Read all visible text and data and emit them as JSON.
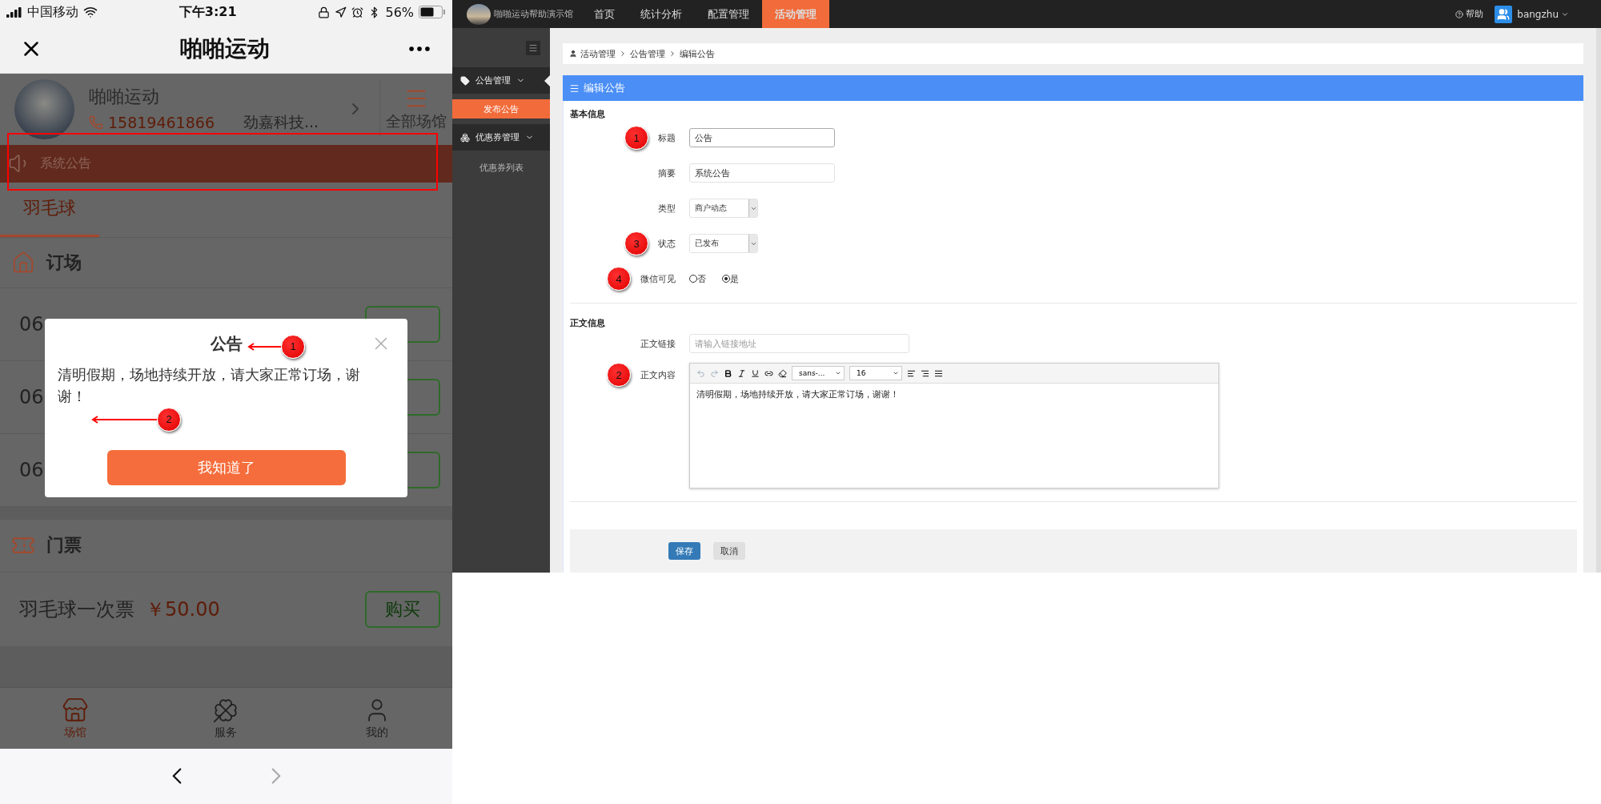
{
  "phone": {
    "status_bar": {
      "carrier": "中国移动",
      "time": "下午3:21",
      "battery": "56%"
    },
    "nav_bar": {
      "title": "啪啪运动"
    },
    "venue": {
      "name": "啪啪运动",
      "phone": "15819461866",
      "company": "劲嘉科技...",
      "all_venues": "全部场馆"
    },
    "notice_bar": {
      "text": "系统公告",
      "highlighted": true
    },
    "sport_tabs": [
      {
        "label": "羽毛球",
        "selected": true
      }
    ],
    "booking": {
      "title": "订场",
      "rows": [
        {
          "label": "06"
        },
        {
          "label": "06"
        },
        {
          "label": "06"
        }
      ]
    },
    "tickets": {
      "title": "门票",
      "items": [
        {
          "name": "羽毛球一次票",
          "price": "￥50.00",
          "button": "购买"
        }
      ]
    },
    "tab_bar": [
      {
        "label": "场馆",
        "selected": true
      },
      {
        "label": "服务",
        "selected": false
      },
      {
        "label": "我的",
        "selected": false
      }
    ],
    "modal": {
      "title": "公告",
      "title_marker": "1",
      "body": "清明假期，场地持续开放，请大家正常订场，谢谢！",
      "body_marker": "2",
      "button": "我知道了"
    }
  },
  "admin": {
    "brand": "啪啪运动帮助演示馆",
    "nav": [
      {
        "label": "首页",
        "selected": false
      },
      {
        "label": "统计分析",
        "selected": false
      },
      {
        "label": "配置管理",
        "selected": false
      },
      {
        "label": "活动管理",
        "selected": true
      }
    ],
    "help": "帮助",
    "user": "bangzhu",
    "sidebar": [
      {
        "label": "公告管理",
        "expanded": true,
        "children": [
          {
            "label": "发布公告",
            "selected": true
          }
        ]
      },
      {
        "label": "优惠券管理",
        "expanded": true,
        "children": [
          {
            "label": "优惠券列表",
            "selected": false
          }
        ]
      }
    ],
    "breadcrumb": [
      "活动管理",
      "公告管理",
      "编辑公告"
    ],
    "panel_title": "编辑公告",
    "sections": [
      {
        "title": "基本信息",
        "fields": [
          {
            "kind": "input",
            "label": "标题",
            "value": "公告",
            "marker": "1"
          },
          {
            "kind": "input",
            "label": "摘要",
            "value": "系统公告"
          },
          {
            "kind": "select",
            "label": "类型",
            "value": "商户动态"
          },
          {
            "kind": "select",
            "label": "状态",
            "value": "已发布",
            "marker": "3"
          },
          {
            "kind": "radio",
            "label": "微信可见",
            "marker": "4",
            "options": [
              {
                "label": "否",
                "selected": false
              },
              {
                "label": "是",
                "selected": true
              }
            ]
          }
        ]
      },
      {
        "title": "正文信息",
        "fields": [
          {
            "kind": "input",
            "label": "正文链接",
            "placeholder": "请输入链接地址"
          },
          {
            "kind": "editor",
            "label": "正文内容",
            "marker": "2",
            "font": "sans-...",
            "size": "16",
            "value": "清明假期，场地持续开放，请大家正常订场，谢谢！"
          }
        ]
      }
    ],
    "actions": [
      {
        "label": "保存",
        "kind": "primary"
      },
      {
        "label": "取消",
        "kind": "default"
      }
    ]
  }
}
